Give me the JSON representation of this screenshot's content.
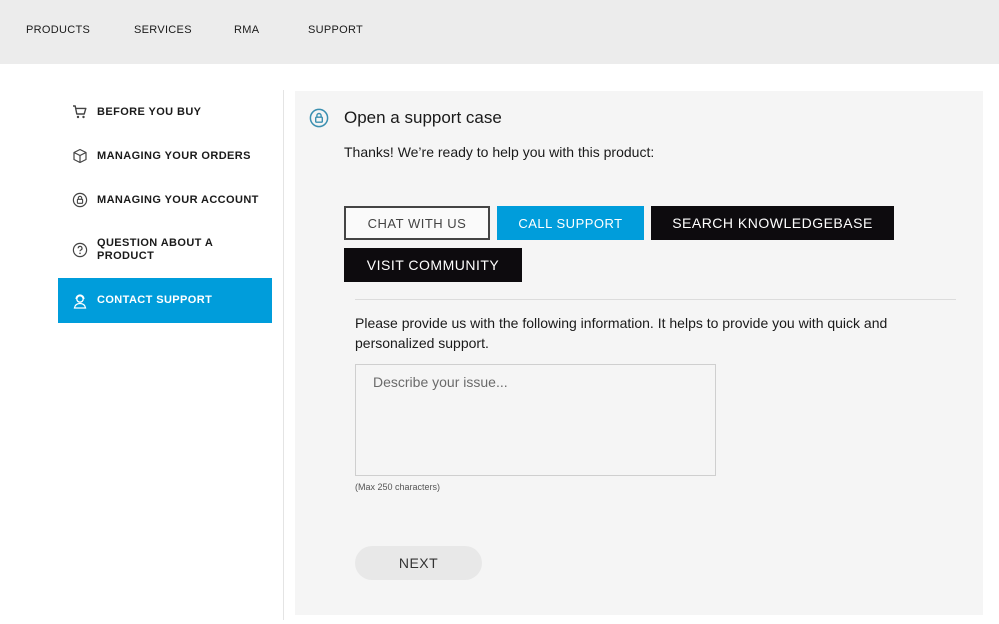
{
  "topnav": {
    "items": [
      "PRODUCTS",
      "SERVICES",
      "RMA",
      "SUPPORT"
    ]
  },
  "sidebar": {
    "items": [
      {
        "label": "BEFORE YOU BUY",
        "icon": "cart-icon",
        "active": false
      },
      {
        "label": "MANAGING YOUR ORDERS",
        "icon": "box-icon",
        "active": false
      },
      {
        "label": "MANAGING YOUR ACCOUNT",
        "icon": "account-lock-icon",
        "active": false
      },
      {
        "label": "QUESTION ABOUT A PRODUCT",
        "icon": "question-icon",
        "active": false
      },
      {
        "label": "CONTACT SUPPORT",
        "icon": "support-agent-icon",
        "active": true
      }
    ]
  },
  "main": {
    "title": "Open a support case",
    "subtitle": "Thanks! We’re ready to help you with this product:",
    "buttons": {
      "chat": "CHAT WITH US",
      "call": "CALL SUPPORT",
      "knowledgebase": "SEARCH KNOWLEDGEBASE",
      "community": "VISIT COMMUNITY"
    },
    "info_text": "Please provide us with the following information. It helps to provide you with quick and personalized support.",
    "issue_placeholder": "Describe your issue...",
    "max_chars_note": "(Max 250 characters)",
    "next_label": "NEXT"
  },
  "colors": {
    "accent": "#009ddb",
    "dark_button": "#0d0b0e",
    "panel_bg": "#f5f5f5",
    "topbar_bg": "#ececec"
  }
}
